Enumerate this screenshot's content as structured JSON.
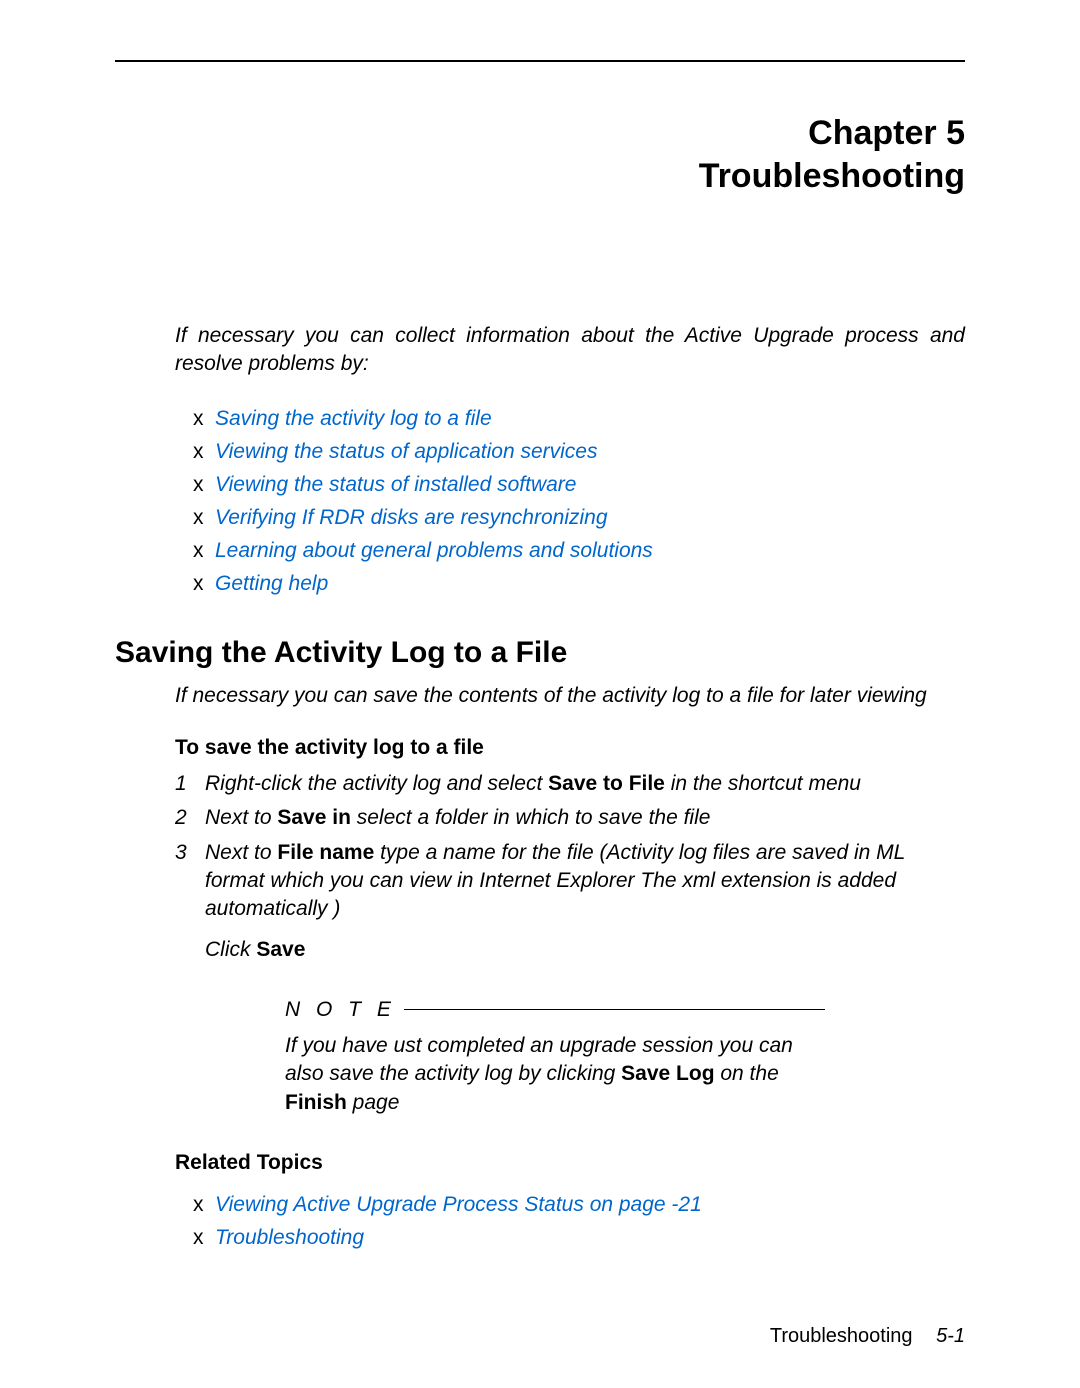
{
  "chapter": {
    "line1": "Chapter 5",
    "line2": "Troubleshooting"
  },
  "intro": "If necessary you can collect information about the Active Upgrade process and resolve problems by:",
  "topLinks": [
    "Saving the activity log to a file",
    "Viewing the status of application services",
    "Viewing the status of installed software",
    "Verifying If RDR disks are resynchronizing",
    "Learning about general problems and solutions",
    "Getting help"
  ],
  "sectionTitle": "Saving the Activity Log to a File",
  "sectionIntro": "If necessary you can save the contents of the activity log to a file for later viewing",
  "procTitle": "To save the activity log to a file",
  "steps": [
    {
      "n": "1",
      "pre": "Right-click the activity log and select ",
      "b": "Save to File",
      "post": " in the shortcut menu"
    },
    {
      "n": "2",
      "pre": "Next to ",
      "b": "Save in",
      "post": " select a folder in which to save the file"
    },
    {
      "n": "3",
      "pre": "Next to ",
      "b": "File name",
      "post": " type a name for the file (Activity log files are saved in ML format which you can view in Internet Explorer The xml extension is added automatically )"
    }
  ],
  "clickSave": {
    "pre": "Click ",
    "b": "Save"
  },
  "note": {
    "label": "N O T E",
    "body_pre": "If you have ust completed an upgrade session you can also save the activity log by clicking ",
    "b1": "Save Log",
    "body_mid": " on the ",
    "b2": "Finish",
    "body_post": " page"
  },
  "relatedTitle": "Related Topics",
  "relatedLinks": [
    "Viewing Active Upgrade Process Status on page   -21",
    "Troubleshooting"
  ],
  "footer": {
    "title": "Troubleshooting",
    "page": "5-1"
  }
}
